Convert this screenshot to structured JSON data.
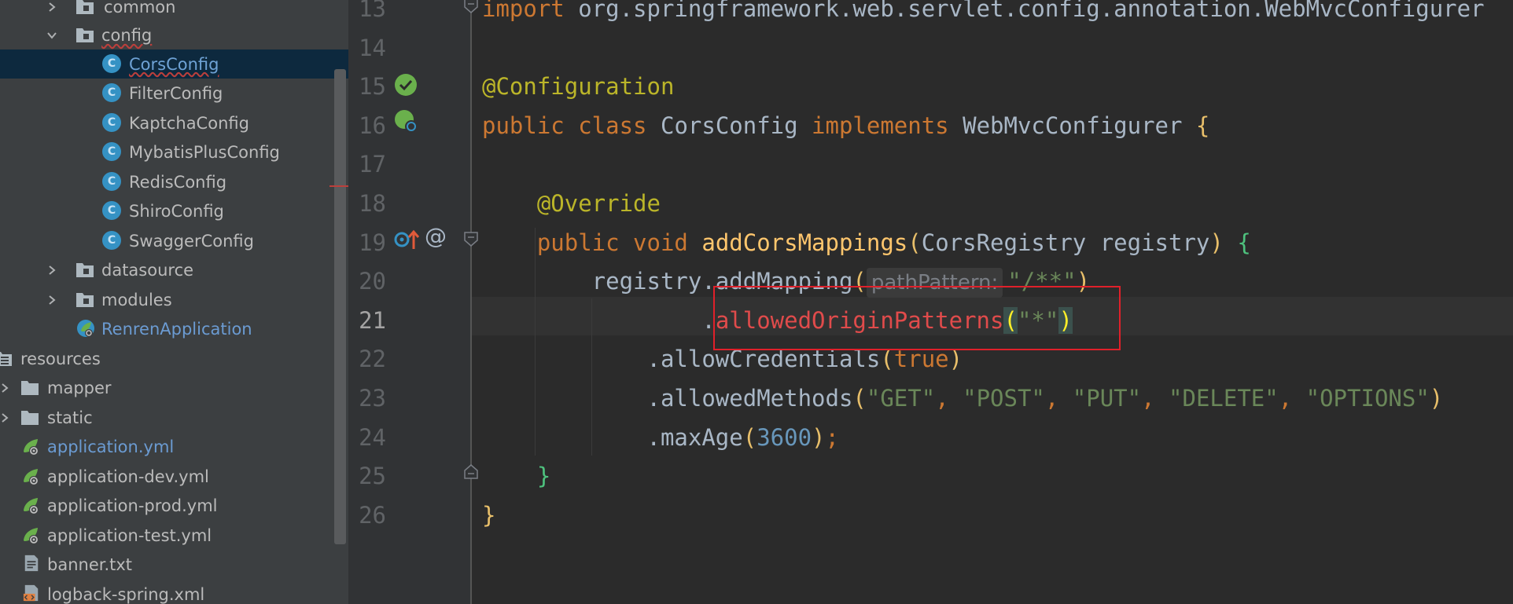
{
  "project_tree": {
    "items": [
      {
        "label": "common",
        "type": "folder",
        "expanded": false
      },
      {
        "label": "config",
        "type": "folder",
        "expanded": true
      },
      {
        "label": "CorsConfig",
        "type": "class",
        "selected": true
      },
      {
        "label": "FilterConfig",
        "type": "class"
      },
      {
        "label": "KaptchaConfig",
        "type": "class"
      },
      {
        "label": "MybatisPlusConfig",
        "type": "class"
      },
      {
        "label": "RedisConfig",
        "type": "class"
      },
      {
        "label": "ShiroConfig",
        "type": "class"
      },
      {
        "label": "SwaggerConfig",
        "type": "class"
      },
      {
        "label": "datasource",
        "type": "folder",
        "expanded": false
      },
      {
        "label": "modules",
        "type": "folder",
        "expanded": false
      },
      {
        "label": "RenrenApplication",
        "type": "spring-boot-app"
      },
      {
        "label": "resources",
        "type": "resources-folder"
      },
      {
        "label": "mapper",
        "type": "folder"
      },
      {
        "label": "static",
        "type": "folder"
      },
      {
        "label": "application.yml",
        "type": "spring-yml"
      },
      {
        "label": "application-dev.yml",
        "type": "spring-yml"
      },
      {
        "label": "application-prod.yml",
        "type": "spring-yml"
      },
      {
        "label": "application-test.yml",
        "type": "spring-yml"
      },
      {
        "label": "banner.txt",
        "type": "text-file"
      },
      {
        "label": "logback-spring.xml",
        "type": "xml-file"
      }
    ]
  },
  "editor": {
    "current_line": "21",
    "lines": [
      {
        "num": "13",
        "tokens": [
          {
            "t": "import ",
            "c": "kw"
          },
          {
            "t": "org.springframework.web.servlet.config.annotation.WebMvcConfigurer",
            "c": ""
          }
        ]
      },
      {
        "num": "14",
        "tokens": []
      },
      {
        "num": "15",
        "tokens": [
          {
            "t": "@Configuration",
            "c": "ann"
          }
        ]
      },
      {
        "num": "16",
        "tokens": [
          {
            "t": "public class ",
            "c": "kw"
          },
          {
            "t": "CorsConfig ",
            "c": ""
          },
          {
            "t": "implements ",
            "c": "kw"
          },
          {
            "t": "WebMvcConfigurer ",
            "c": ""
          },
          {
            "t": "{",
            "c": "brace"
          }
        ]
      },
      {
        "num": "17",
        "tokens": []
      },
      {
        "num": "18",
        "tokens": [
          {
            "t": "    @Override",
            "c": "ann"
          }
        ]
      },
      {
        "num": "19",
        "tokens": [
          {
            "t": "    public void ",
            "c": "kw"
          },
          {
            "t": "addCorsMappings",
            "c": "fn"
          },
          {
            "t": "(",
            "c": "brace"
          },
          {
            "t": "CorsRegistry registry",
            "c": ""
          },
          {
            "t": ")",
            "c": "brace"
          },
          {
            "t": " {",
            "c": "brace2"
          }
        ]
      },
      {
        "num": "20",
        "tokens": [
          {
            "t": "        registry.addMapping",
            "c": ""
          },
          {
            "t": "(",
            "c": "brace"
          },
          {
            "t": "pathPattern:",
            "c": "hint"
          },
          {
            "t": "\"/**\"",
            "c": "str"
          },
          {
            "t": ")",
            "c": "brace"
          }
        ]
      },
      {
        "num": "21",
        "tokens": [
          {
            "t": "                .",
            "c": ""
          },
          {
            "t": "allowedOriginPatterns",
            "c": "err-red"
          },
          {
            "t": "(",
            "c": "bm"
          },
          {
            "t": "\"*\"",
            "c": "str"
          },
          {
            "t": ")",
            "c": "bm"
          }
        ]
      },
      {
        "num": "22",
        "tokens": [
          {
            "t": "            .allowCredentials",
            "c": ""
          },
          {
            "t": "(",
            "c": "brace"
          },
          {
            "t": "true",
            "c": "kw"
          },
          {
            "t": ")",
            "c": "brace"
          }
        ]
      },
      {
        "num": "23",
        "tokens": [
          {
            "t": "            .allowedMethods",
            "c": ""
          },
          {
            "t": "(",
            "c": "brace"
          },
          {
            "t": "\"GET\"",
            "c": "str"
          },
          {
            "t": ", ",
            "c": "kw"
          },
          {
            "t": "\"POST\"",
            "c": "str"
          },
          {
            "t": ", ",
            "c": "kw"
          },
          {
            "t": "\"PUT\"",
            "c": "str"
          },
          {
            "t": ", ",
            "c": "kw"
          },
          {
            "t": "\"DELETE\"",
            "c": "str"
          },
          {
            "t": ", ",
            "c": "kw"
          },
          {
            "t": "\"OPTIONS\"",
            "c": "str"
          },
          {
            "t": ")",
            "c": "brace"
          }
        ]
      },
      {
        "num": "24",
        "tokens": [
          {
            "t": "            .maxAge",
            "c": ""
          },
          {
            "t": "(",
            "c": "brace"
          },
          {
            "t": "3600",
            "c": "num"
          },
          {
            "t": ")",
            "c": "brace"
          },
          {
            "t": ";",
            "c": "kw"
          }
        ]
      },
      {
        "num": "25",
        "tokens": [
          {
            "t": "    }",
            "c": "brace2"
          }
        ]
      },
      {
        "num": "26",
        "tokens": [
          {
            "t": "}",
            "c": "brace"
          }
        ]
      }
    ]
  },
  "colors": {
    "panel_bg": "#3c3f41",
    "editor_bg": "#2b2b2b",
    "selection": "#0d293e",
    "highlight_box": "#e0202a"
  }
}
